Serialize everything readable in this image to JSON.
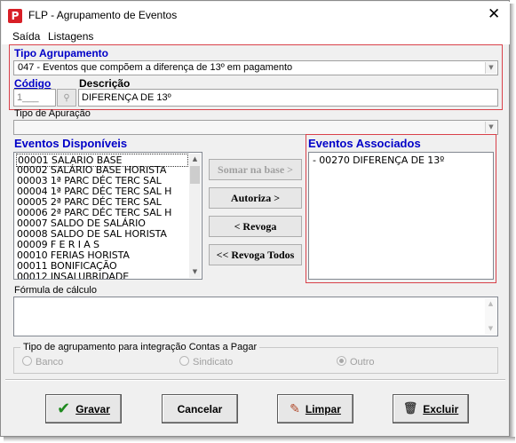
{
  "window": {
    "title": "FLP - Agrupamento de Eventos",
    "icon_letter": "P",
    "close_glyph": "✕"
  },
  "menu": {
    "items": [
      "Saída",
      "Listagens"
    ]
  },
  "tipo_agrupamento": {
    "label": "Tipo Agrupamento",
    "value": "047 - Eventos que compõem a diferença de 13º em pagamento"
  },
  "codigo": {
    "label": "Código",
    "value": "1___"
  },
  "descricao": {
    "label": "Descrição",
    "value": "DIFERENÇA DE 13º"
  },
  "tipo_apuracao": {
    "label": "Tipo de Apuração",
    "value": ""
  },
  "eventos_disponiveis": {
    "label": "Eventos Disponíveis",
    "items": [
      "00001 SALARIO BASE",
      "00002 SALÁRIO BASE HORISTA",
      "00003 1ª PARC DÉC TERC SAL",
      "00004 1ª PARC DÉC TERC SAL H",
      "00005 2ª PARC DÉC TERC SAL",
      "00006 2ª PARC DÉC TERC SAL H",
      "00007 SALDO DE SALÁRIO",
      "00008 SALDO DE SAL HORISTA",
      "00009 F E R I A S",
      "00010 FERIAS HORISTA",
      "00011 BONIFICAÇÃO",
      "00012 INSALUBRIDADE"
    ]
  },
  "buttons_mid": {
    "somar": "Somar na base >",
    "autoriza": "Autoriza >",
    "revoga": "< Revoga",
    "revoga_todos": "<< Revoga Todos"
  },
  "eventos_associados": {
    "label": "Eventos Associados",
    "items": [
      "00270 DIFERENÇA DE 13º"
    ]
  },
  "formula": {
    "label": "Fórmula de cálculo",
    "value": ""
  },
  "integracao": {
    "label": "Tipo de agrupamento para integração Contas a Pagar",
    "options": [
      "Banco",
      "Sindicato",
      "Outro"
    ],
    "selected": "Outro"
  },
  "footer": {
    "gravar": "Gravar",
    "cancelar": "Cancelar",
    "limpar": "Limpar",
    "excluir": "Excluir"
  },
  "colors": {
    "accent_blue": "#0000c8",
    "highlight_red": "#d9414a",
    "check_green": "#1f8a1f"
  }
}
